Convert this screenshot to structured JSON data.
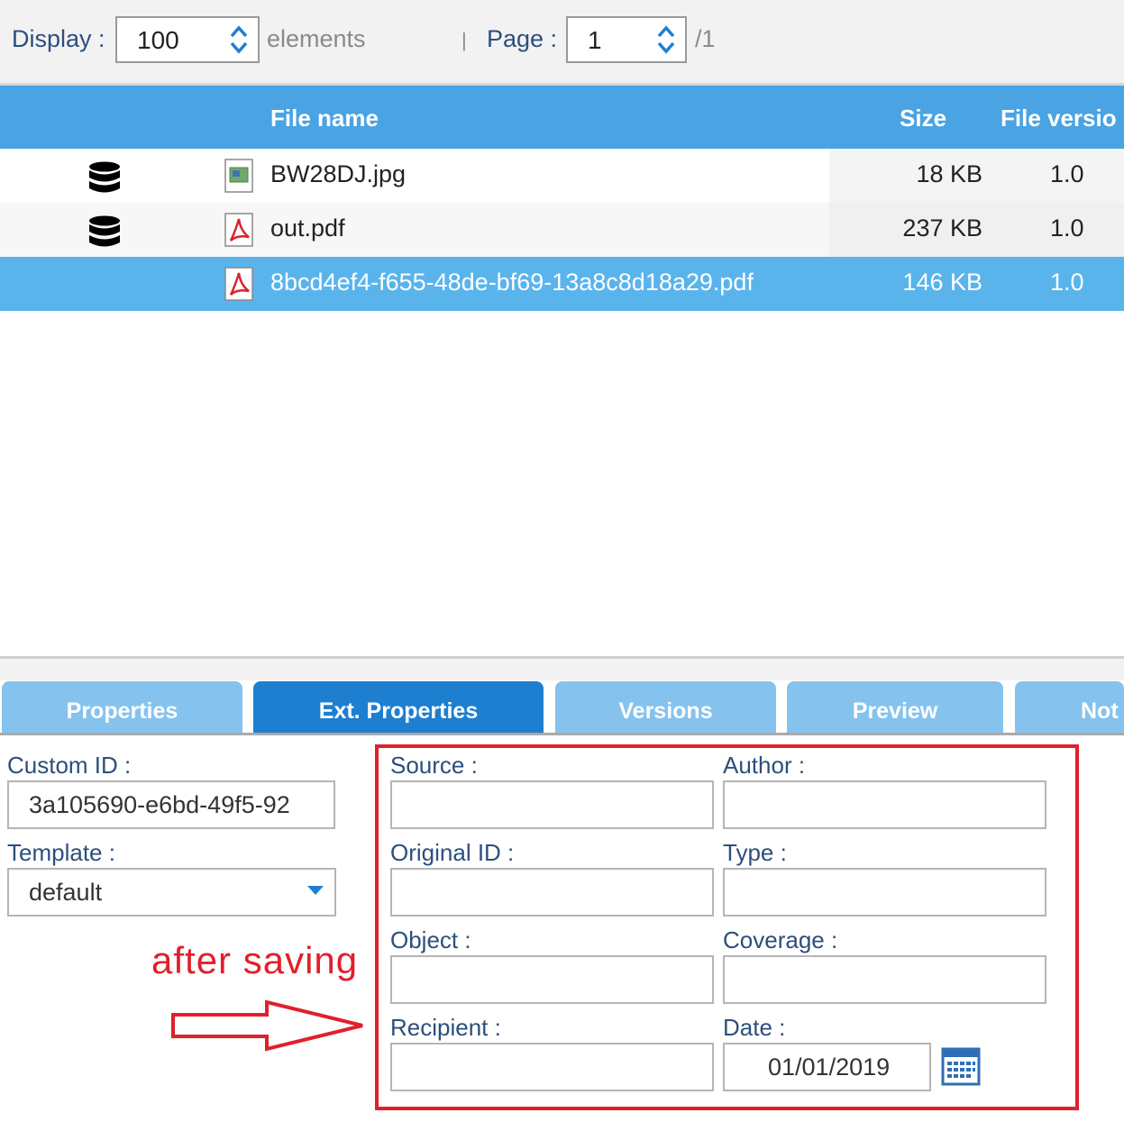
{
  "paging": {
    "display_label": "Display :",
    "display_value": "100",
    "elements_label": "elements",
    "separator": "|",
    "page_label": "Page :",
    "page_value": "1",
    "page_total": "/1"
  },
  "grid": {
    "columns": {
      "name": "File name",
      "size": "Size",
      "version": "File versio"
    },
    "rows": [
      {
        "name": "BW28DJ.jpg",
        "size": "18 KB",
        "version": "1.0",
        "icon": "image-file-icon",
        "stored": true
      },
      {
        "name": "out.pdf",
        "size": "237 KB",
        "version": "1.0",
        "icon": "pdf-file-icon",
        "stored": true
      },
      {
        "name": "8bcd4ef4-f655-48de-bf69-13a8c8d18a29.pdf",
        "size": "146 KB",
        "version": "1.0",
        "icon": "pdf-file-icon",
        "stored": false,
        "selected": true
      }
    ]
  },
  "tabs": [
    {
      "label": "Properties",
      "active": false
    },
    {
      "label": "Ext. Properties",
      "active": true
    },
    {
      "label": "Versions",
      "active": false
    },
    {
      "label": "Preview",
      "active": false
    },
    {
      "label": "Not",
      "active": false
    }
  ],
  "form": {
    "custom_id": {
      "label": "Custom ID :",
      "value": "3a105690-e6bd-49f5-92"
    },
    "template": {
      "label": "Template :",
      "value": "default"
    },
    "source": {
      "label": "Source :",
      "value": ""
    },
    "author": {
      "label": "Author :",
      "value": ""
    },
    "original_id": {
      "label": "Original ID :",
      "value": ""
    },
    "type": {
      "label": "Type :",
      "value": ""
    },
    "object": {
      "label": "Object :",
      "value": ""
    },
    "coverage": {
      "label": "Coverage :",
      "value": ""
    },
    "recipient": {
      "label": "Recipient :",
      "value": ""
    },
    "date": {
      "label": "Date :",
      "value": "01/01/2019"
    }
  },
  "annotation": {
    "text": "after saving",
    "color": "#e0202a"
  },
  "colors": {
    "header_blue": "#4aa3e2",
    "selected_row": "#5ab4ec",
    "active_tab": "#1e7fd1",
    "inactive_tab": "#85c3ee"
  }
}
